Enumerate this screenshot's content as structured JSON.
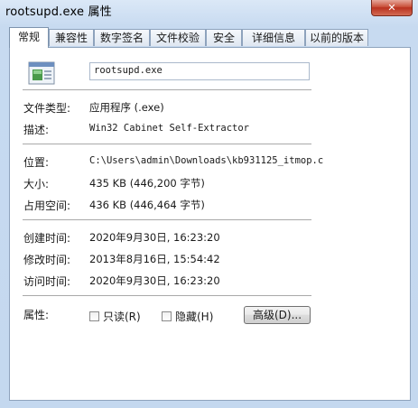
{
  "window": {
    "title": "rootsupd.exe 属性",
    "close_glyph": "✕"
  },
  "tabs": [
    {
      "label": "常规"
    },
    {
      "label": "兼容性"
    },
    {
      "label": "数字签名"
    },
    {
      "label": "文件校验"
    },
    {
      "label": "安全"
    },
    {
      "label": "详细信息"
    },
    {
      "label": "以前的版本"
    }
  ],
  "general": {
    "file_name": "rootsupd.exe",
    "file_type_label": "文件类型:",
    "file_type_value": "应用程序 (.exe)",
    "description_label": "描述:",
    "description_value": "Win32 Cabinet Self-Extractor",
    "location_label": "位置:",
    "location_value": "C:\\Users\\admin\\Downloads\\kb931125_itmop.c",
    "size_label": "大小:",
    "size_value": "435 KB (446,200 字节)",
    "disk_size_label": "占用空间:",
    "disk_size_value": "436 KB (446,464 字节)",
    "created_label": "创建时间:",
    "created_value": "2020年9月30日, 16:23:20",
    "modified_label": "修改时间:",
    "modified_value": "2013年8月16日, 15:54:42",
    "accessed_label": "访问时间:",
    "accessed_value": "2020年9月30日, 16:23:20",
    "attributes_label": "属性:",
    "readonly_label": "只读(R)",
    "readonly_checked": false,
    "hidden_label": "隐藏(H)",
    "hidden_checked": false,
    "advanced_button": "高级(D)..."
  }
}
